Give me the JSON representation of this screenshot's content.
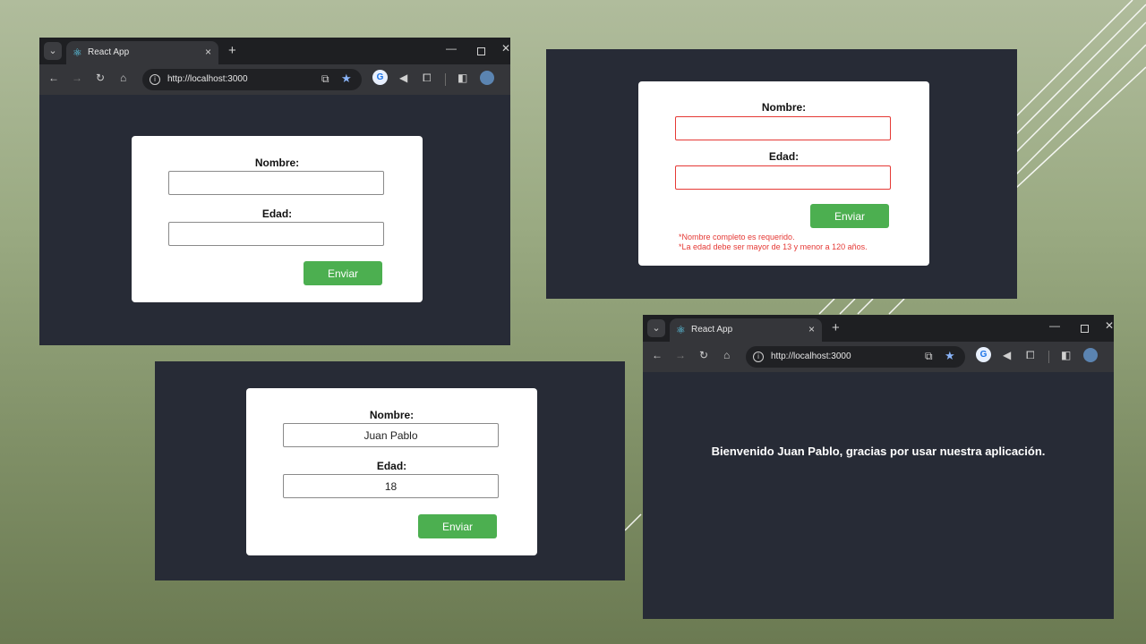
{
  "browser": {
    "tab_menu_icon": "chevron-down-icon",
    "tab_icon": "react-icon",
    "tab_title": "React App",
    "tab_close": "×",
    "new_tab": "+",
    "min_glyph": "—",
    "close_glyph": "✕",
    "back_glyph": "←",
    "forward_glyph": "→",
    "reload_glyph": "↻",
    "home_glyph": "⌂",
    "url": "http://localhost:3000",
    "star_glyph": "★",
    "open_glyph": "⧉",
    "translate_glyph": "G",
    "sound_glyph": "◀",
    "extensions_glyph": "⧠",
    "sidepanel_glyph": "◧"
  },
  "form": {
    "name_label": "Nombre:",
    "age_label": "Edad:",
    "submit_label": "Enviar"
  },
  "panel_filled": {
    "name_value": "Juan Pablo",
    "age_value": "18"
  },
  "panel_errors": {
    "error_name": "*Nombre completo es requerido.",
    "error_age": "*La edad debe ser mayor de 13 y menor a 120 años."
  },
  "panel_welcome": {
    "message": "Bienvenido Juan Pablo, gracias por usar nuestra aplicación."
  },
  "colors": {
    "panel_bg": "#272b36",
    "button_green": "#4caf50",
    "error_red": "#e53935"
  }
}
